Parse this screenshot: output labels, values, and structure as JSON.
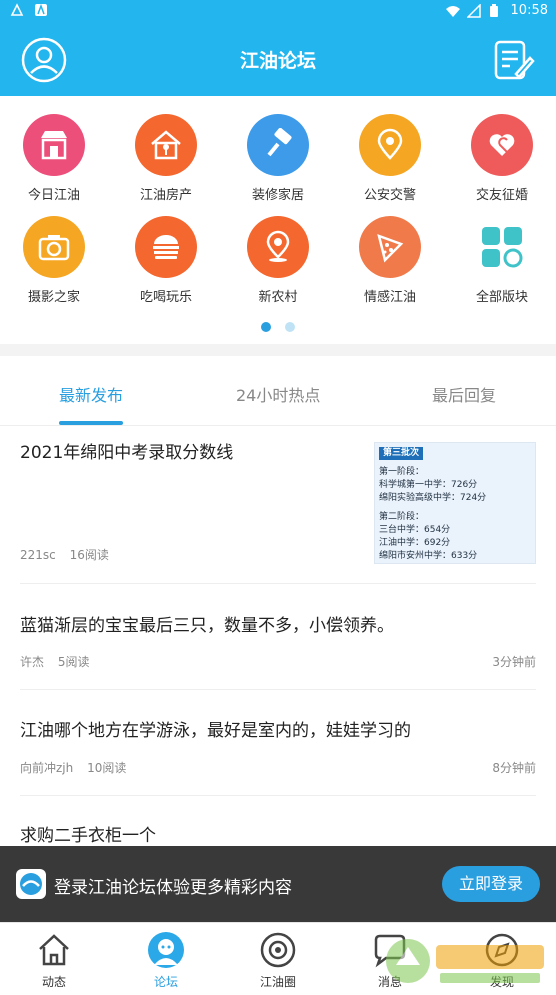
{
  "statusbar": {
    "time": "10:58"
  },
  "header": {
    "title": "江油论坛"
  },
  "categories": [
    {
      "label": "今日江油",
      "icon": "shop-icon",
      "color": "#ec4f7a"
    },
    {
      "label": "江油房产",
      "icon": "house-key-icon",
      "color": "#f4672f"
    },
    {
      "label": "装修家居",
      "icon": "paint-roller-icon",
      "color": "#3d9be9"
    },
    {
      "label": "公安交警",
      "icon": "location-pin-icon",
      "color": "#f5a623"
    },
    {
      "label": "交友征婚",
      "icon": "hearts-icon",
      "color": "#ef5b5b"
    },
    {
      "label": "摄影之家",
      "icon": "camera-icon",
      "color": "#f5a623"
    },
    {
      "label": "吃喝玩乐",
      "icon": "burger-icon",
      "color": "#f4672f"
    },
    {
      "label": "新农村",
      "icon": "map-pin-icon",
      "color": "#f4672f"
    },
    {
      "label": "情感江油",
      "icon": "pizza-icon",
      "color": "#f07a4a"
    },
    {
      "label": "全部版块",
      "icon": "grid-icon",
      "color": "#3fc3c9"
    }
  ],
  "tabs": [
    {
      "label": "最新发布",
      "active": true
    },
    {
      "label": "24小时热点",
      "active": false
    },
    {
      "label": "最后回复",
      "active": false
    }
  ],
  "posts": [
    {
      "title": "2021年绵阳中考录取分数线",
      "author": "221sc",
      "reads": "16阅读",
      "time": "",
      "thumb": {
        "tag": "第三批次",
        "lines": [
          "第一阶段：",
          "科学城第一中学：726分",
          "绵阳实验高级中学：724分",
          "",
          "第二阶段：",
          "三台中学：654分",
          "江油中学：692分",
          "绵阳市安州中学：633分"
        ]
      }
    },
    {
      "title": "蓝猫渐层的宝宝最后三只，数量不多，小偿领养。",
      "author": "许杰",
      "reads": "5阅读",
      "time": "3分钟前"
    },
    {
      "title": "江油哪个地方在学游泳，最好是室内的，娃娃学习的",
      "author": "向前冲zjh",
      "reads": "10阅读",
      "time": "8分钟前"
    },
    {
      "title": "求购二手衣柜一个",
      "author": "",
      "reads": "",
      "time": ""
    }
  ],
  "banner": {
    "text": "登录江油论坛体验更多精彩内容",
    "button": "立即登录"
  },
  "bottomnav": [
    {
      "label": "动态",
      "icon": "home-icon"
    },
    {
      "label": "论坛",
      "icon": "forum-avatar-icon",
      "active": true
    },
    {
      "label": "江油圈",
      "icon": "circle-camera-icon"
    },
    {
      "label": "消息",
      "icon": "message-icon"
    },
    {
      "label": "发现",
      "icon": "discover-icon"
    }
  ],
  "colors": {
    "primary": "#23b5ee",
    "accent": "#2a9fe0"
  }
}
